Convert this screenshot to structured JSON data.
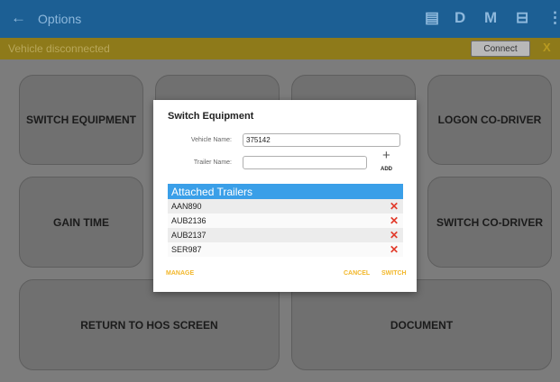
{
  "topbar": {
    "back_icon": "←",
    "title": "Options",
    "icons": [
      {
        "name": "chat-icon",
        "glyph": "▤"
      },
      {
        "name": "d-icon",
        "glyph": "D"
      },
      {
        "name": "m-icon",
        "glyph": "M"
      },
      {
        "name": "device-icon",
        "glyph": "⊟"
      },
      {
        "name": "more-icon",
        "glyph": "⋮"
      }
    ],
    "color": "#1c5f94"
  },
  "banner": {
    "text": "Vehicle disconnected",
    "connect_label": "Connect",
    "close_label": "X",
    "color": "#8e7a1a"
  },
  "tiles": [
    {
      "label": "SWITCH EQUIPMENT"
    },
    {
      "label": ""
    },
    {
      "label": ""
    },
    {
      "label": "LOGON CO-DRIVER"
    },
    {
      "label": "GAIN TIME"
    },
    {
      "label": ""
    },
    {
      "label": ""
    },
    {
      "label": "SWITCH CO-DRIVER"
    },
    {
      "label": "RETURN TO HOS SCREEN"
    },
    {
      "label": "DOCUMENT"
    }
  ],
  "dialog": {
    "title": "Switch Equipment",
    "vehicle_label": "Vehicle Name:",
    "vehicle_value": "375142",
    "trailer_label": "Trailer Name:",
    "trailer_value": "",
    "add_icon": "+",
    "add_label": "ADD",
    "list_header": "Attached Trailers",
    "trailers": [
      "AAN890",
      "AUB2136",
      "AUB2137",
      "SER987"
    ],
    "remove_icon": "✕",
    "manage_label": "MANAGE",
    "cancel_label": "CANCEL",
    "switch_label": "SWITCH",
    "accent": "#3a9fe8",
    "button_color": "#f2b72a",
    "remove_color": "#e23a2a"
  }
}
